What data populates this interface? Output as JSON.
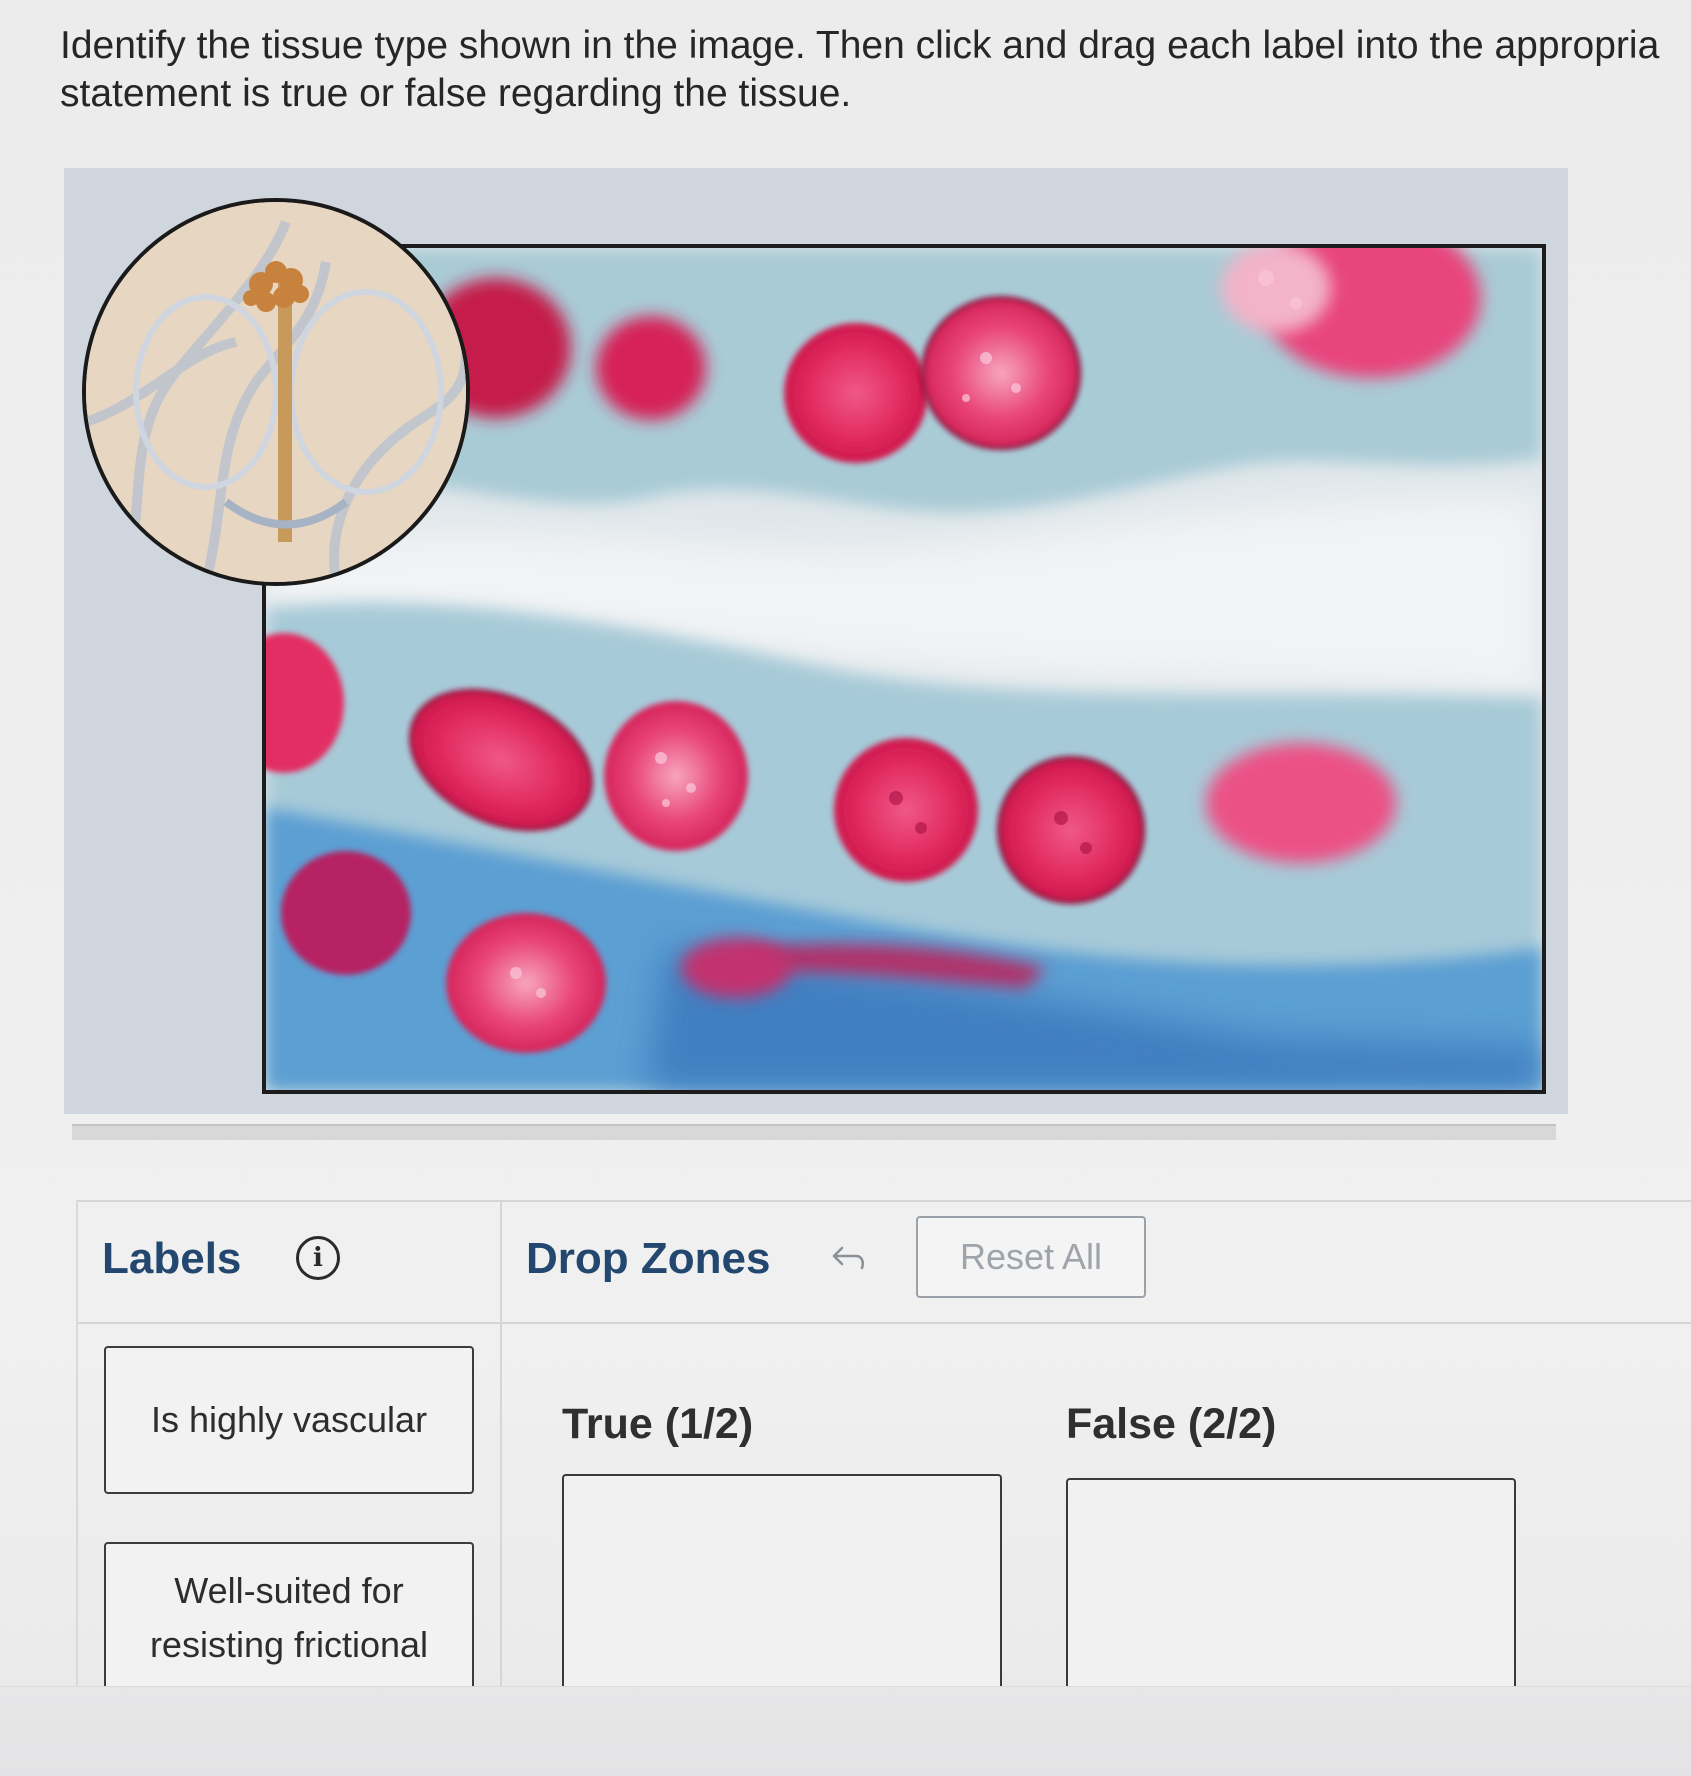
{
  "question": {
    "line1": "Identify the tissue type shown in the image. Then click and drag each label into the appropria",
    "line2": "statement is true or false regarding the tissue."
  },
  "figure": {
    "image_subject": "stained tissue micrograph",
    "inset_subject": "gland illustration inset"
  },
  "labels_panel": {
    "heading": "Labels",
    "info_icon": "info-icon",
    "items": [
      {
        "text": "Is highly vascular"
      },
      {
        "text": "Well-suited for resisting frictional"
      }
    ]
  },
  "drop_zones": {
    "heading": "Drop Zones",
    "undo_icon": "undo-arrow-icon",
    "reset_label": "Reset All",
    "zones": [
      {
        "title": "True (1/2)"
      },
      {
        "title": "False (2/2)"
      }
    ]
  },
  "colors": {
    "heading_blue": "#23476f",
    "nucleus_magenta": "#e0265a",
    "cytoplasm_teal": "#9fc6d4",
    "reset_gray": "#9ea4aa"
  }
}
